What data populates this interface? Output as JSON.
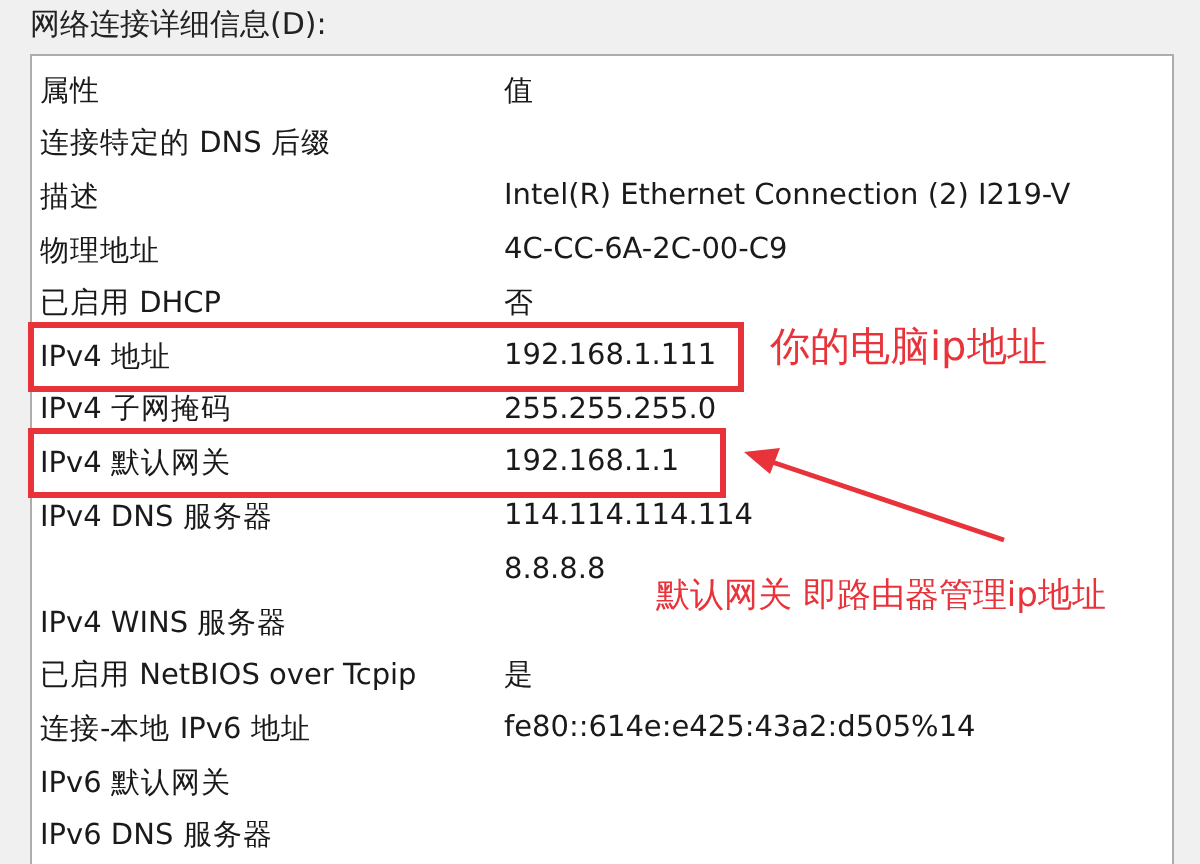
{
  "group_label": "网络连接详细信息(D):",
  "columns": [
    "属性",
    "值"
  ],
  "rows": [
    {
      "property": "连接特定的 DNS 后缀",
      "highlighted": false
    },
    {
      "property": "描述",
      "value": "Intel(R) Ethernet Connection (2) I219-V",
      "highlighted": false
    },
    {
      "property": "物理地址",
      "value": "4C-CC-6A-2C-00-C9",
      "highlighted": false
    },
    {
      "property": "已启用 DHCP",
      "value": "否",
      "highlighted": false
    },
    {
      "property": "IPv4 地址",
      "value": "192.168.1.111",
      "highlighted": true
    },
    {
      "property": "IPv4 子网掩码",
      "value": "255.255.255.0",
      "highlighted": false
    },
    {
      "property": "IPv4 默认网关",
      "value": "192.168.1.1",
      "highlighted": true
    },
    {
      "property": "IPv4 DNS 服务器",
      "value": "114.114.114.114",
      "highlighted": false
    },
    {
      "value": "8.8.8.8",
      "highlighted": false
    },
    {
      "property": "IPv4 WINS 服务器",
      "highlighted": false
    },
    {
      "property": "已启用 NetBIOS over Tcpip",
      "value": "是",
      "highlighted": false
    },
    {
      "property": "连接-本地 IPv6 地址",
      "value": "fe80::614e:e425:43a2:d505%14",
      "highlighted": false
    },
    {
      "property": "IPv6 默认网关",
      "highlighted": false
    },
    {
      "property": "IPv6 DNS 服务器",
      "highlighted": false
    }
  ],
  "annotations": [
    {
      "kind": "label",
      "text": "你的电脑ip地址"
    },
    {
      "kind": "arrow-label",
      "text": "默认网关 即路由器管理ip地址"
    }
  ]
}
